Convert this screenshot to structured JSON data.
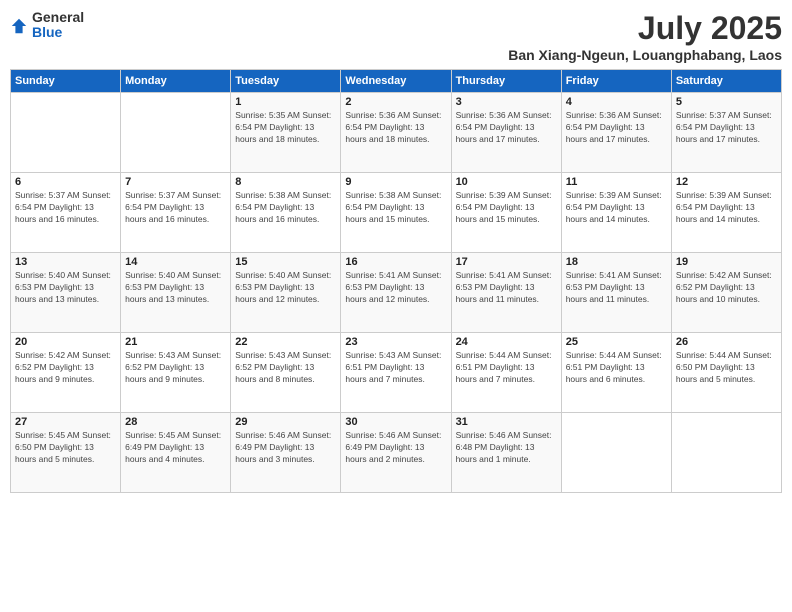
{
  "header": {
    "logo_general": "General",
    "logo_blue": "Blue",
    "month": "July 2025",
    "location": "Ban Xiang-Ngeun, Louangphabang, Laos"
  },
  "weekdays": [
    "Sunday",
    "Monday",
    "Tuesday",
    "Wednesday",
    "Thursday",
    "Friday",
    "Saturday"
  ],
  "weeks": [
    [
      {
        "day": "",
        "info": ""
      },
      {
        "day": "",
        "info": ""
      },
      {
        "day": "1",
        "info": "Sunrise: 5:35 AM\nSunset: 6:54 PM\nDaylight: 13 hours and 18 minutes."
      },
      {
        "day": "2",
        "info": "Sunrise: 5:36 AM\nSunset: 6:54 PM\nDaylight: 13 hours and 18 minutes."
      },
      {
        "day": "3",
        "info": "Sunrise: 5:36 AM\nSunset: 6:54 PM\nDaylight: 13 hours and 17 minutes."
      },
      {
        "day": "4",
        "info": "Sunrise: 5:36 AM\nSunset: 6:54 PM\nDaylight: 13 hours and 17 minutes."
      },
      {
        "day": "5",
        "info": "Sunrise: 5:37 AM\nSunset: 6:54 PM\nDaylight: 13 hours and 17 minutes."
      }
    ],
    [
      {
        "day": "6",
        "info": "Sunrise: 5:37 AM\nSunset: 6:54 PM\nDaylight: 13 hours and 16 minutes."
      },
      {
        "day": "7",
        "info": "Sunrise: 5:37 AM\nSunset: 6:54 PM\nDaylight: 13 hours and 16 minutes."
      },
      {
        "day": "8",
        "info": "Sunrise: 5:38 AM\nSunset: 6:54 PM\nDaylight: 13 hours and 16 minutes."
      },
      {
        "day": "9",
        "info": "Sunrise: 5:38 AM\nSunset: 6:54 PM\nDaylight: 13 hours and 15 minutes."
      },
      {
        "day": "10",
        "info": "Sunrise: 5:39 AM\nSunset: 6:54 PM\nDaylight: 13 hours and 15 minutes."
      },
      {
        "day": "11",
        "info": "Sunrise: 5:39 AM\nSunset: 6:54 PM\nDaylight: 13 hours and 14 minutes."
      },
      {
        "day": "12",
        "info": "Sunrise: 5:39 AM\nSunset: 6:54 PM\nDaylight: 13 hours and 14 minutes."
      }
    ],
    [
      {
        "day": "13",
        "info": "Sunrise: 5:40 AM\nSunset: 6:53 PM\nDaylight: 13 hours and 13 minutes."
      },
      {
        "day": "14",
        "info": "Sunrise: 5:40 AM\nSunset: 6:53 PM\nDaylight: 13 hours and 13 minutes."
      },
      {
        "day": "15",
        "info": "Sunrise: 5:40 AM\nSunset: 6:53 PM\nDaylight: 13 hours and 12 minutes."
      },
      {
        "day": "16",
        "info": "Sunrise: 5:41 AM\nSunset: 6:53 PM\nDaylight: 13 hours and 12 minutes."
      },
      {
        "day": "17",
        "info": "Sunrise: 5:41 AM\nSunset: 6:53 PM\nDaylight: 13 hours and 11 minutes."
      },
      {
        "day": "18",
        "info": "Sunrise: 5:41 AM\nSunset: 6:53 PM\nDaylight: 13 hours and 11 minutes."
      },
      {
        "day": "19",
        "info": "Sunrise: 5:42 AM\nSunset: 6:52 PM\nDaylight: 13 hours and 10 minutes."
      }
    ],
    [
      {
        "day": "20",
        "info": "Sunrise: 5:42 AM\nSunset: 6:52 PM\nDaylight: 13 hours and 9 minutes."
      },
      {
        "day": "21",
        "info": "Sunrise: 5:43 AM\nSunset: 6:52 PM\nDaylight: 13 hours and 9 minutes."
      },
      {
        "day": "22",
        "info": "Sunrise: 5:43 AM\nSunset: 6:52 PM\nDaylight: 13 hours and 8 minutes."
      },
      {
        "day": "23",
        "info": "Sunrise: 5:43 AM\nSunset: 6:51 PM\nDaylight: 13 hours and 7 minutes."
      },
      {
        "day": "24",
        "info": "Sunrise: 5:44 AM\nSunset: 6:51 PM\nDaylight: 13 hours and 7 minutes."
      },
      {
        "day": "25",
        "info": "Sunrise: 5:44 AM\nSunset: 6:51 PM\nDaylight: 13 hours and 6 minutes."
      },
      {
        "day": "26",
        "info": "Sunrise: 5:44 AM\nSunset: 6:50 PM\nDaylight: 13 hours and 5 minutes."
      }
    ],
    [
      {
        "day": "27",
        "info": "Sunrise: 5:45 AM\nSunset: 6:50 PM\nDaylight: 13 hours and 5 minutes."
      },
      {
        "day": "28",
        "info": "Sunrise: 5:45 AM\nSunset: 6:49 PM\nDaylight: 13 hours and 4 minutes."
      },
      {
        "day": "29",
        "info": "Sunrise: 5:46 AM\nSunset: 6:49 PM\nDaylight: 13 hours and 3 minutes."
      },
      {
        "day": "30",
        "info": "Sunrise: 5:46 AM\nSunset: 6:49 PM\nDaylight: 13 hours and 2 minutes."
      },
      {
        "day": "31",
        "info": "Sunrise: 5:46 AM\nSunset: 6:48 PM\nDaylight: 13 hours and 1 minute."
      },
      {
        "day": "",
        "info": ""
      },
      {
        "day": "",
        "info": ""
      }
    ]
  ]
}
